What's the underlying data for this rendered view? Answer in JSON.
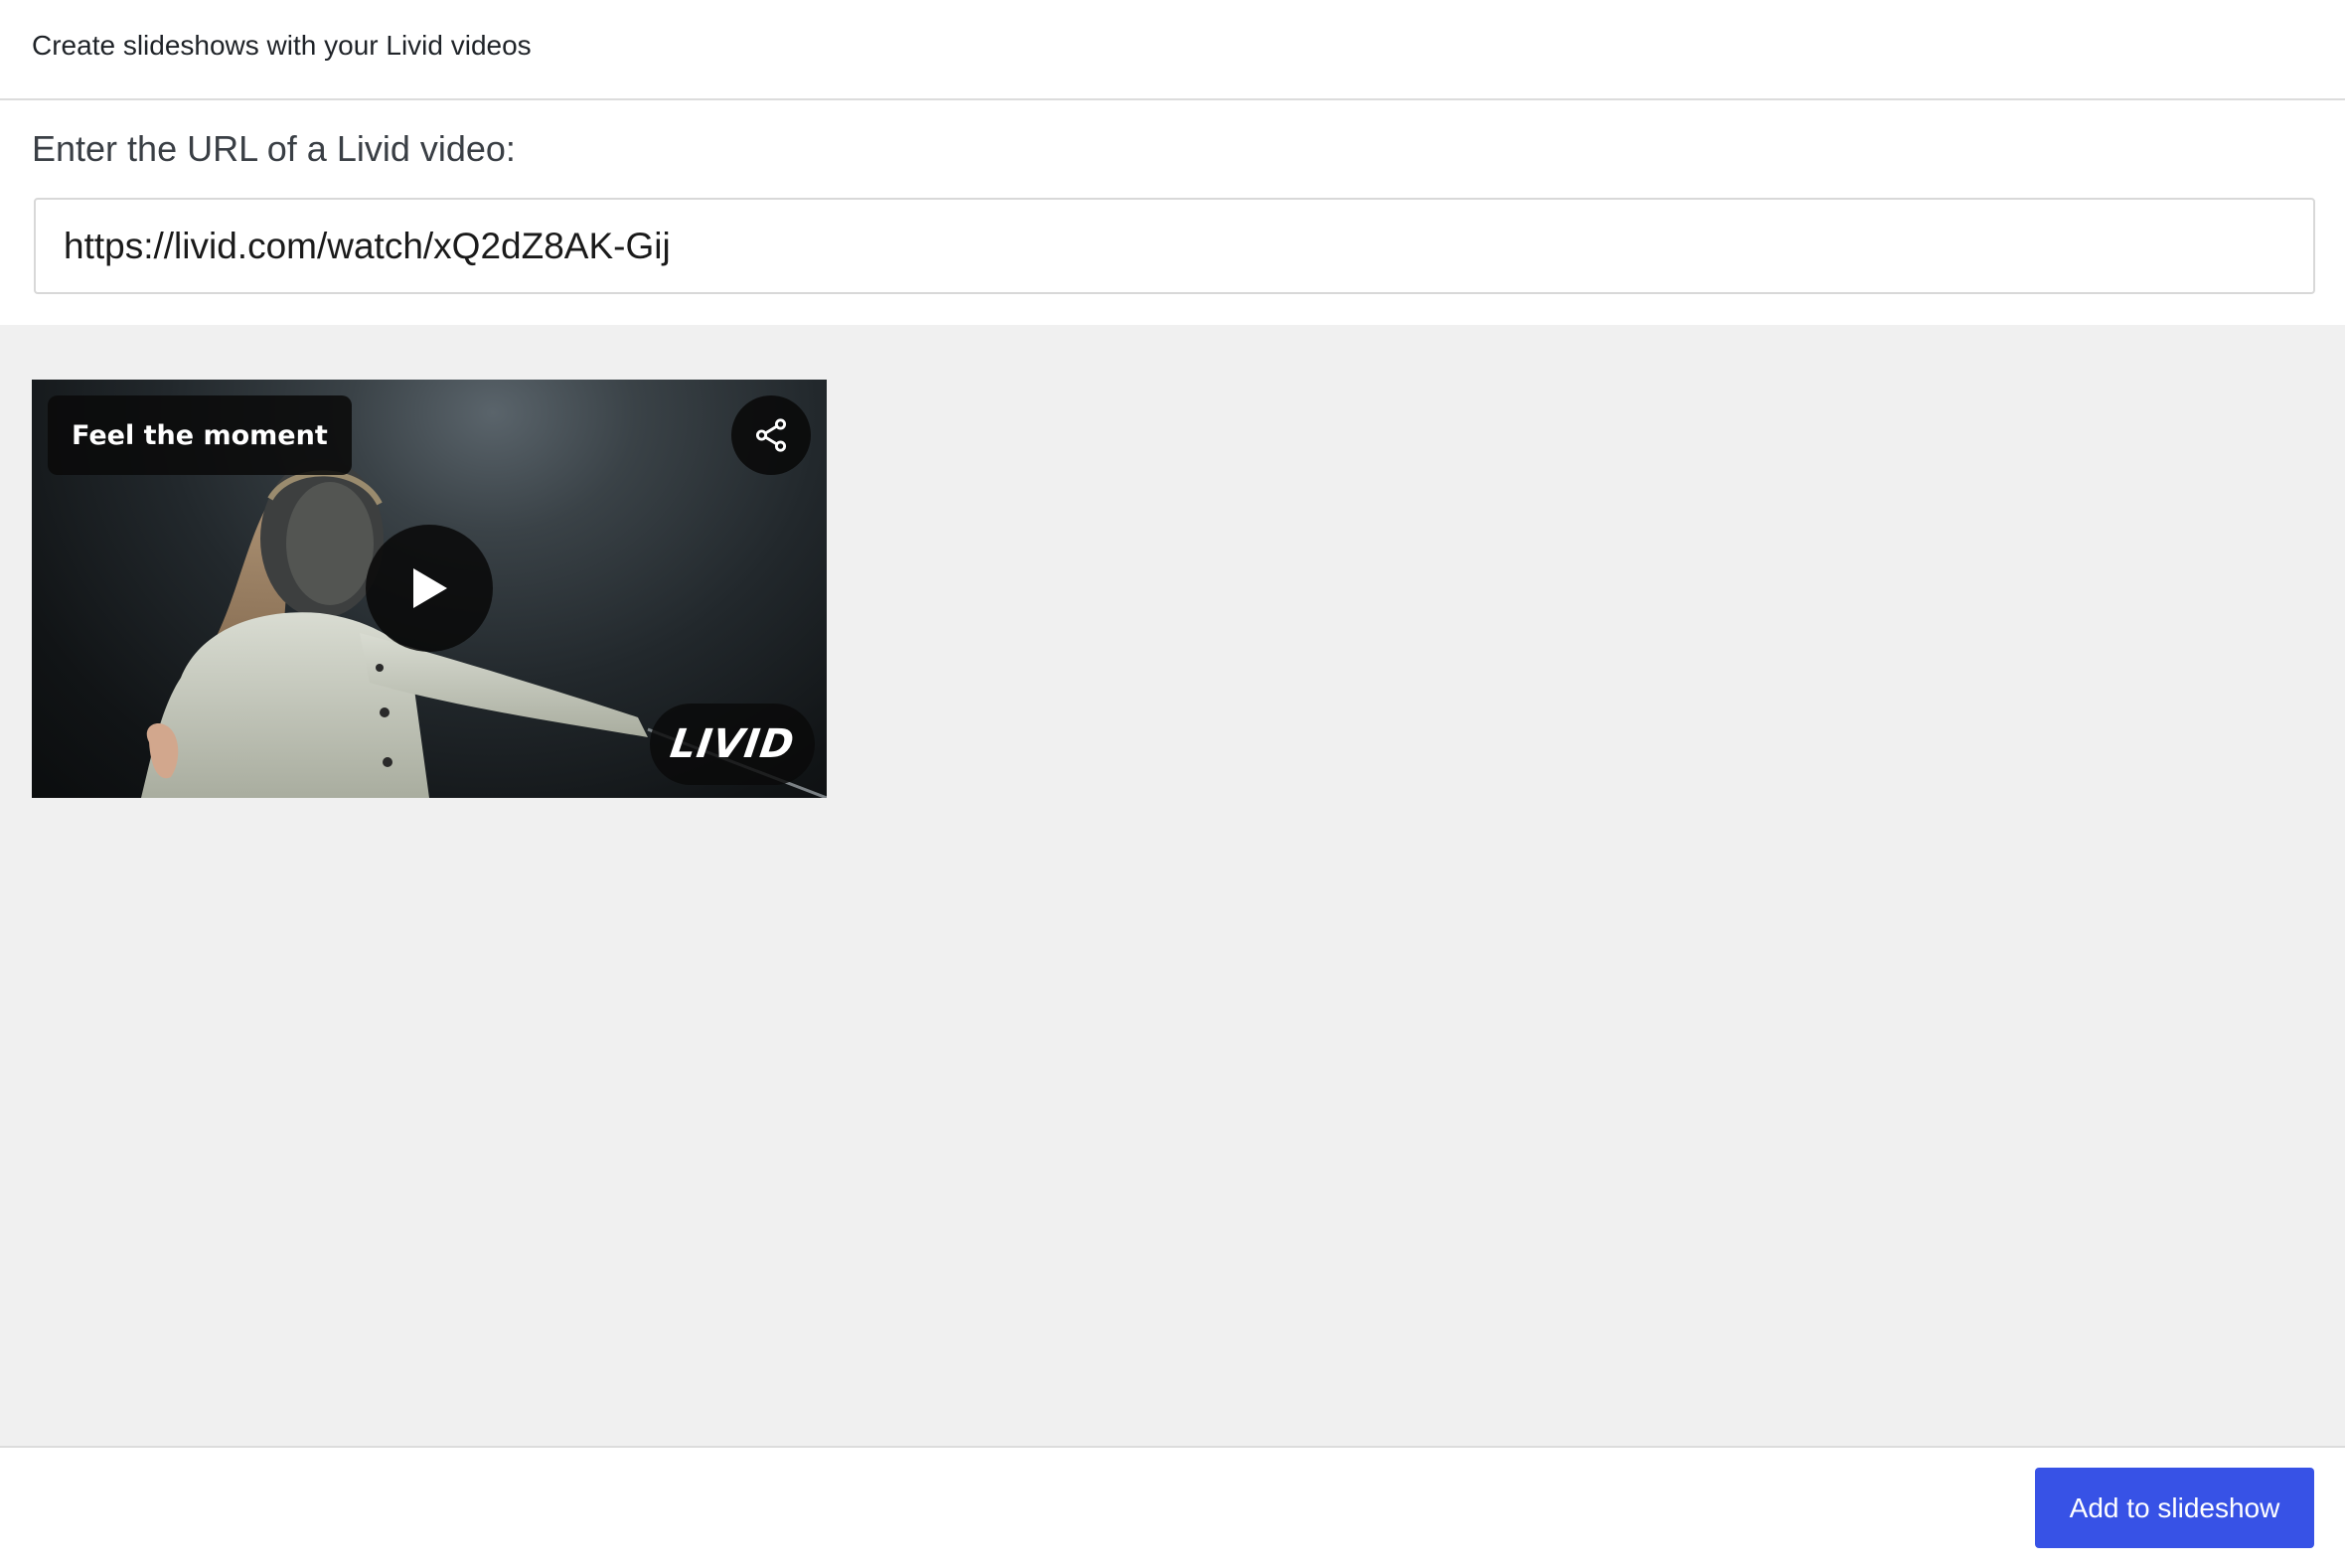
{
  "header": {
    "title": "Create slideshows with your Livid videos"
  },
  "url_section": {
    "label": "Enter the URL of a Livid video:",
    "input_value": "https://livid.com/watch/xQ2dZ8AK-Gij"
  },
  "video": {
    "title": "Feel the moment",
    "logo_text": "LIVID",
    "icons": {
      "share": "share-icon",
      "play": "play-icon"
    }
  },
  "footer": {
    "add_button_label": "Add to slideshow"
  },
  "colors": {
    "accent": "#3752e6",
    "content_bg": "#f0f0f0",
    "divider": "#dcdcdc"
  }
}
